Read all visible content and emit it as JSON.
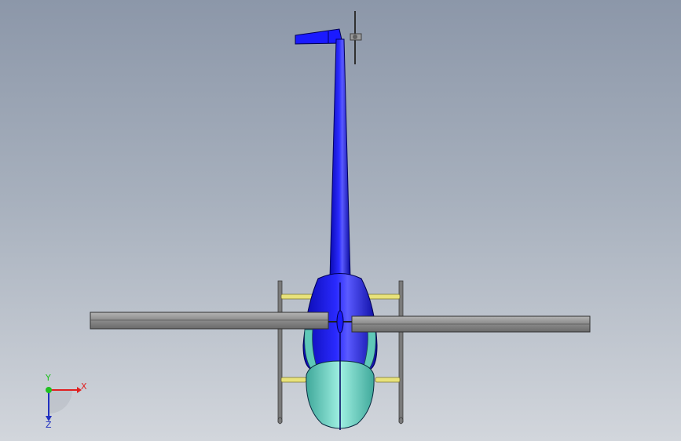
{
  "view": {
    "triad": {
      "x_label": "X",
      "y_label": "Y",
      "z_label": "Z",
      "x_color": "#e02020",
      "y_color": "#20c020",
      "z_color": "#2030c0"
    },
    "colors": {
      "fuselage": "#1a1aff",
      "canopy": "#7fe0d0",
      "blade": "#8a8a8a",
      "strut": "#e8e27a",
      "skid": "#707070"
    }
  }
}
